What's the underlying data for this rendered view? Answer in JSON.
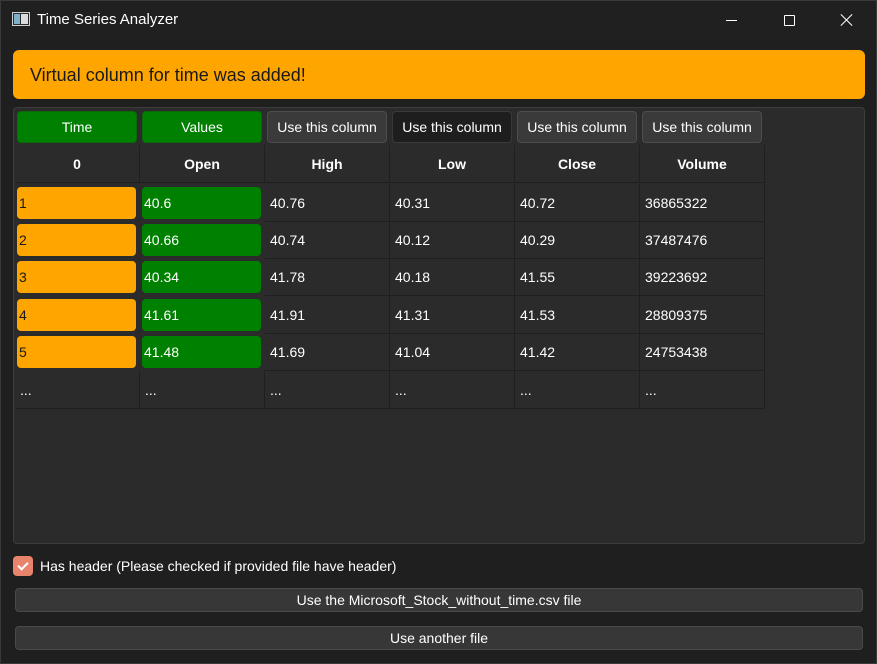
{
  "window": {
    "title": "Time Series Analyzer"
  },
  "banner": {
    "message": "Virtual column for time was added!"
  },
  "table": {
    "column_buttons": [
      "Time",
      "Values",
      "Use this column",
      "Use this column",
      "Use this column",
      "Use this column"
    ],
    "headers": [
      "0",
      "Open",
      "High",
      "Low",
      "Close",
      "Volume"
    ],
    "rows": [
      [
        "1",
        "40.6",
        "40.76",
        "40.31",
        "40.72",
        "36865322"
      ],
      [
        "2",
        "40.66",
        "40.74",
        "40.12",
        "40.29",
        "37487476"
      ],
      [
        "3",
        "40.34",
        "41.78",
        "40.18",
        "41.55",
        "39223692"
      ],
      [
        "4",
        "41.61",
        "41.91",
        "41.31",
        "41.53",
        "28809375"
      ],
      [
        "5",
        "41.48",
        "41.69",
        "41.04",
        "41.42",
        "24753438"
      ],
      [
        "...",
        "...",
        "...",
        "...",
        "...",
        "..."
      ]
    ]
  },
  "options": {
    "has_header_label": "Has header (Please checked if provided file have header)",
    "has_header_checked": true
  },
  "actions": {
    "use_file_label": "Use the Microsoft_Stock_without_time.csv file",
    "use_another_label": "Use another file"
  },
  "colors": {
    "accent_orange": "#ffa500",
    "accent_green": "#008000",
    "checkbox": "#e8846c"
  },
  "icons": {
    "app": "app-window-icon",
    "minimize": "minimize-icon",
    "maximize": "maximize-icon",
    "close": "close-icon",
    "check": "checkmark-icon"
  }
}
